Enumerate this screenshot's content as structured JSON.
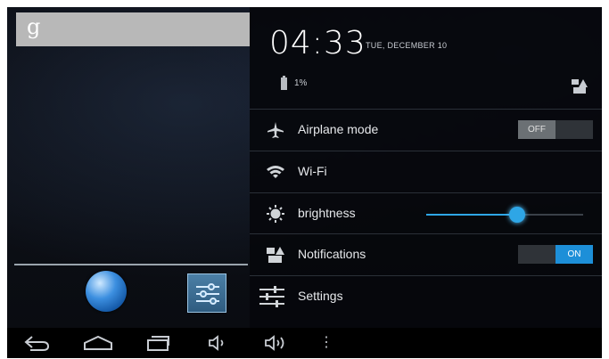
{
  "home": {
    "search_glyph": "g",
    "dock_apps": [
      {
        "name": "browser",
        "icon": "globe-icon"
      },
      {
        "name": "settings",
        "icon": "settings-sliders-icon"
      }
    ]
  },
  "quick_settings": {
    "time": "04:33",
    "date": "TUE, DECEMBER 10",
    "battery": "1%",
    "rows": [
      {
        "label": "Airplane mode",
        "icon": "airplane-icon",
        "toggle": "OFF"
      },
      {
        "label": "Wi-Fi",
        "icon": "wifi-icon"
      },
      {
        "label": "brightness",
        "icon": "brightness-icon",
        "level_fraction": 0.58
      },
      {
        "label": "Notifications",
        "icon": "notifications-icon",
        "toggle": "ON"
      },
      {
        "label": "Settings",
        "icon": "settings-icon"
      }
    ]
  },
  "navbar": {
    "more_glyph": "⋮",
    "buttons": [
      "back-icon",
      "home-icon",
      "recent-apps-icon",
      "volume-down-icon",
      "volume-up-icon",
      "menu-icon"
    ]
  },
  "colors": {
    "accent": "#2ea6e6",
    "toggle_on": "#1d8fd8",
    "panel_bg": "#06080c"
  }
}
